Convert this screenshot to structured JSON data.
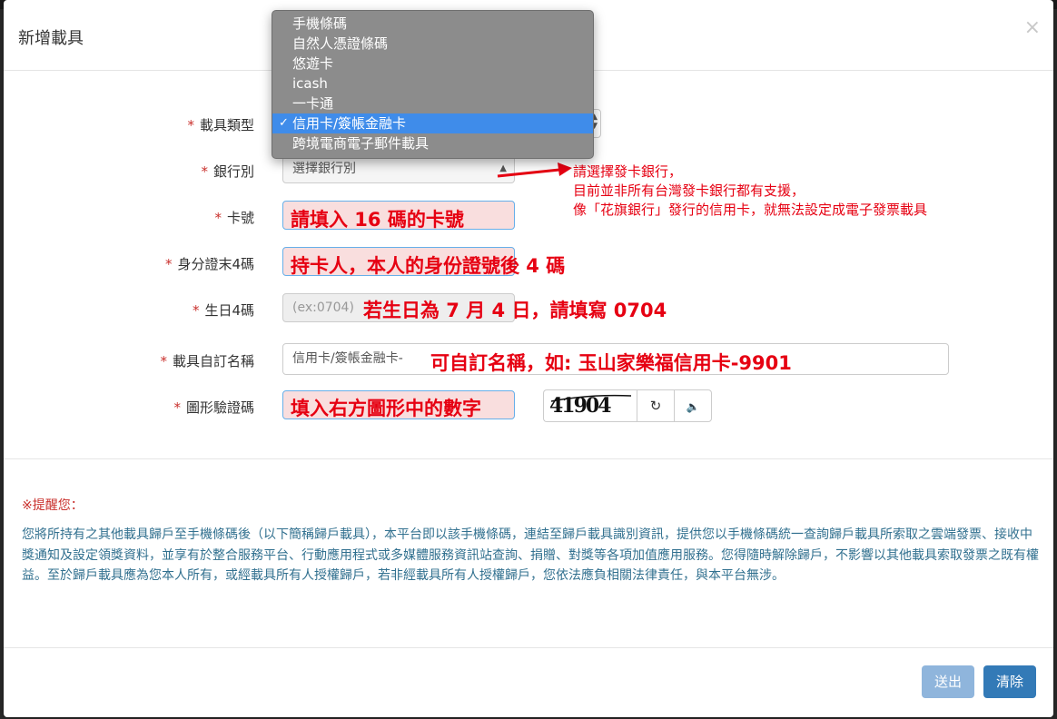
{
  "modal": {
    "title": "新增載具",
    "close": "×"
  },
  "form": {
    "required_mark": "*",
    "carrier_type": {
      "label": "載具類型",
      "options": [
        "手機條碼",
        "自然人憑證條碼",
        "悠遊卡",
        "icash",
        "一卡通",
        "信用卡/簽帳金融卡",
        "跨境電商電子郵件載具"
      ],
      "selected": "信用卡/簽帳金融卡",
      "check": "✓"
    },
    "bank": {
      "label": "銀行別",
      "value": "選擇銀行別",
      "arrow": "▲"
    },
    "card_no": {
      "label": "卡號",
      "hint": "請填入 16 碼的卡號"
    },
    "id_last4": {
      "label": "身分證末4碼",
      "hint": "持卡人，本人的身份證號後 4 碼"
    },
    "birthday4": {
      "label": "生日4碼",
      "placeholder": "(ex:0704)",
      "hint": "若生日為 7 月 4 日，請填寫 0704"
    },
    "custom_name": {
      "label": "載具自訂名稱",
      "value": "信用卡/簽帳金融卡-",
      "hint": "可自訂名稱，如: 玉山家樂福信用卡-9901"
    },
    "captcha": {
      "label": "圖形驗證碼",
      "hint": "填入右方圖形中的數字",
      "image_text": "41904",
      "refresh_icon": "↻",
      "audio_icon": "🔈"
    }
  },
  "annotation": {
    "bank_note": [
      "請選擇發卡銀行，",
      "目前並非所有台灣發卡銀行都有支援，",
      "像「花旗銀行」發行的信用卡，就無法設定成電子發票載具"
    ]
  },
  "notice": {
    "title": "※提醒您：",
    "body": "您將所持有之其他載具歸戶至手機條碼後（以下簡稱歸戶載具），本平台即以該手機條碼，連結至歸戶載具識別資訊，提供您以手機條碼統一查詢歸戶載具所索取之雲端發票、接收中獎通知及設定領獎資料，並享有於整合服務平台、行動應用程式或多媒體服務資訊站查詢、捐贈、對獎等各項加值應用服務。您得隨時解除歸戶，不影響以其他載具索取發票之既有權益。至於歸戶載具應為您本人所有，或經載具所有人授權歸戶，若非經載具所有人授權歸戶，您依法應負相關法律責任，與本平台無涉。"
  },
  "footer": {
    "submit": "送出",
    "clear": "清除"
  },
  "colors": {
    "annotation_red": "#e60012",
    "primary": "#337ab7",
    "primary_disabled": "#8fb5dc",
    "notice_text": "#31708f",
    "dropdown_selected": "#3f8cea"
  }
}
